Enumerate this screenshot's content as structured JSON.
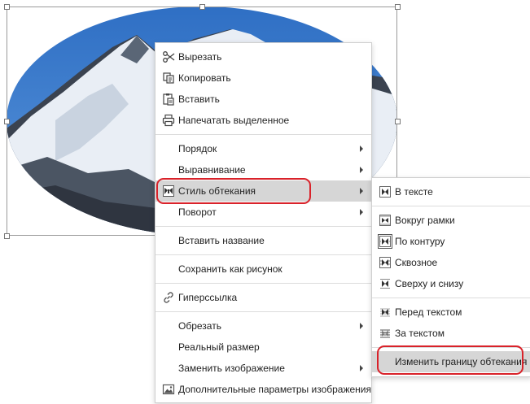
{
  "context_menu": {
    "items": [
      {
        "id": "cut",
        "label": "Вырезать",
        "icon": "scissors-icon",
        "submenu": false
      },
      {
        "id": "copy",
        "label": "Копировать",
        "icon": "copy-icon",
        "submenu": false
      },
      {
        "id": "paste",
        "label": "Вставить",
        "icon": "paste-icon",
        "submenu": false
      },
      {
        "id": "print",
        "label": "Напечатать выделенное",
        "icon": "printer-icon",
        "submenu": false
      },
      {
        "id": "order",
        "label": "Порядок",
        "submenu": true
      },
      {
        "id": "align",
        "label": "Выравнивание",
        "submenu": true
      },
      {
        "id": "wrap",
        "label": "Стиль обтекания",
        "icon": "wrap-style-icon",
        "submenu": true,
        "highlighted": true
      },
      {
        "id": "rotate",
        "label": "Поворот",
        "submenu": true
      },
      {
        "id": "caption",
        "label": "Вставить название",
        "submenu": false
      },
      {
        "id": "save_as_picture",
        "label": "Сохранить как рисунок",
        "submenu": false
      },
      {
        "id": "hyperlink",
        "label": "Гиперссылка",
        "icon": "link-icon",
        "submenu": false
      },
      {
        "id": "crop",
        "label": "Обрезать",
        "submenu": true
      },
      {
        "id": "actual_size",
        "label": "Реальный размер",
        "submenu": false
      },
      {
        "id": "replace_image",
        "label": "Заменить изображение",
        "submenu": true
      },
      {
        "id": "image_settings",
        "label": "Дополнительные параметры изображения",
        "icon": "image-icon",
        "submenu": false
      }
    ]
  },
  "wrap_submenu": {
    "items": [
      {
        "id": "inline",
        "label": "В тексте",
        "icon": "wrap-inline-icon"
      },
      {
        "id": "square",
        "label": "Вокруг рамки",
        "icon": "wrap-square-icon"
      },
      {
        "id": "tight",
        "label": "По контуру",
        "icon": "wrap-tight-icon",
        "selected": true
      },
      {
        "id": "through",
        "label": "Сквозное",
        "icon": "wrap-through-icon"
      },
      {
        "id": "top_bottom",
        "label": "Сверху и снизу",
        "icon": "wrap-top-bottom-icon"
      },
      {
        "id": "in_front",
        "label": "Перед текстом",
        "icon": "wrap-in-front-icon"
      },
      {
        "id": "behind",
        "label": "За текстом",
        "icon": "wrap-behind-icon"
      },
      {
        "id": "edit_boundary",
        "label": "Изменить границу обтекания",
        "highlighted": true
      }
    ]
  },
  "colors": {
    "highlight": "#d6d6d6",
    "annotation_ring": "#d9222a",
    "sky": "#3d7fcf",
    "menu_border": "#cfcfcf"
  }
}
